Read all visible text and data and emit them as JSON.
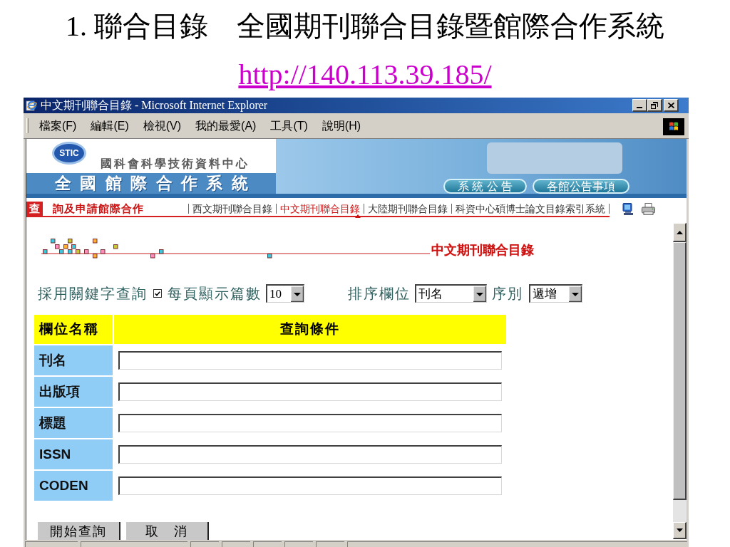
{
  "slide": {
    "heading": "1. 聯合目錄",
    "title": "全國期刊聯合目錄暨館際合作系統",
    "url": "http://140.113.39.185/"
  },
  "window": {
    "title": "中文期刊聯合目錄 - Microsoft Internet Explorer"
  },
  "menu": [
    "檔案(F)",
    "編輯(E)",
    "檢視(V)",
    "我的最愛(A)",
    "工具(T)",
    "說明(H)"
  ],
  "banner": {
    "logo": "STIC",
    "organization": "國科會科學技術資料中心",
    "system_name": "全 國 館 際 合 作 系 統",
    "buttons": [
      "系 統 公 告",
      "各館公告事項"
    ]
  },
  "nav": {
    "badge": "查",
    "title": "詢及申請館際合作",
    "links": [
      {
        "label": "西文期刊聯合目錄",
        "selected": false
      },
      {
        "label": "中文期刊聯合目錄",
        "selected": true
      },
      {
        "label": "大陸期刊聯合目錄",
        "selected": false
      },
      {
        "label": "科資中心碩博士論文目錄索引系統",
        "selected": false
      }
    ]
  },
  "page_heading": "中文期刊聯合目錄",
  "options": {
    "keyword_label": "採用關鍵字查詢",
    "keyword_checked": true,
    "per_page_label": "每頁顯示篇數",
    "per_page": "10",
    "sort_label": "排序欄位",
    "sort_field": "刊名",
    "order_label": "序別",
    "order": "遞增"
  },
  "table": {
    "columns": [
      "欄位名稱",
      "查詢條件"
    ],
    "rows": [
      {
        "label": "刊名"
      },
      {
        "label": "出版項"
      },
      {
        "label": "標題"
      },
      {
        "label": "ISSN"
      },
      {
        "label": "CODEN"
      }
    ]
  },
  "buttons": [
    "開始查詢",
    "取　消"
  ]
}
